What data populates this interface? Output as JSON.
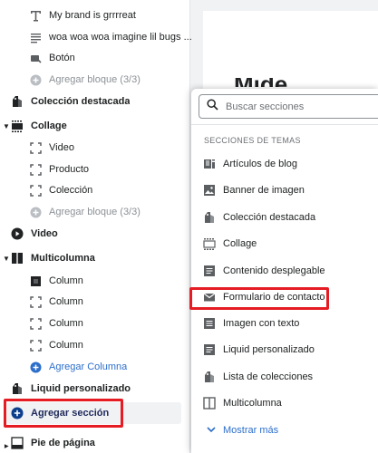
{
  "sidebar": {
    "items": [
      {
        "label": "My brand is grrrreat"
      },
      {
        "label": "woa woa woa imagine lil bugs ..."
      },
      {
        "label": "Botón"
      },
      {
        "label": "Agregar bloque (3/3)"
      },
      {
        "label": "Colección destacada"
      },
      {
        "label": "Collage"
      },
      {
        "label": "Video"
      },
      {
        "label": "Producto"
      },
      {
        "label": "Colección"
      },
      {
        "label": "Agregar bloque (3/3)"
      },
      {
        "label": "Video"
      },
      {
        "label": "Multicolumna"
      },
      {
        "label": "Column"
      },
      {
        "label": "Column"
      },
      {
        "label": "Column"
      },
      {
        "label": "Column"
      },
      {
        "label": "Agregar Columna"
      },
      {
        "label": "Liquid personalizado"
      },
      {
        "label": "Agregar sección"
      },
      {
        "label": "Pie de página"
      }
    ]
  },
  "popup": {
    "search_placeholder": "Buscar secciones",
    "section_title": "SECCIONES DE TEMAS",
    "items": [
      {
        "label": "Artículos de blog"
      },
      {
        "label": "Banner de imagen"
      },
      {
        "label": "Colección destacada"
      },
      {
        "label": "Collage"
      },
      {
        "label": "Contenido desplegable"
      },
      {
        "label": "Formulario de contacto"
      },
      {
        "label": "Imagen con texto"
      },
      {
        "label": "Liquid personalizado"
      },
      {
        "label": "Lista de colecciones"
      },
      {
        "label": "Multicolumna"
      }
    ],
    "show_more": "Mostrar más"
  },
  "colors": {
    "accent_blue": "#2c6ecb",
    "highlight_red": "#e51c23",
    "agregar_icon": "#0b3e8c"
  },
  "icons": {
    "text": "text-t-icon",
    "paragraph": "paragraph-lines-icon",
    "button": "button-icon",
    "add_block": "plus-circle-icon",
    "featured_collection": "tag-icon",
    "collage": "collage-icon",
    "block_square": "dashed-square-icon",
    "video": "play-circle-icon",
    "multicolumn": "columns-icon",
    "search": "search-icon",
    "blog": "blog-icon",
    "image": "image-icon",
    "collapsible": "list-icon",
    "envelope": "envelope-icon",
    "image_text": "image-text-icon",
    "chevron": "chevron-down-icon"
  }
}
